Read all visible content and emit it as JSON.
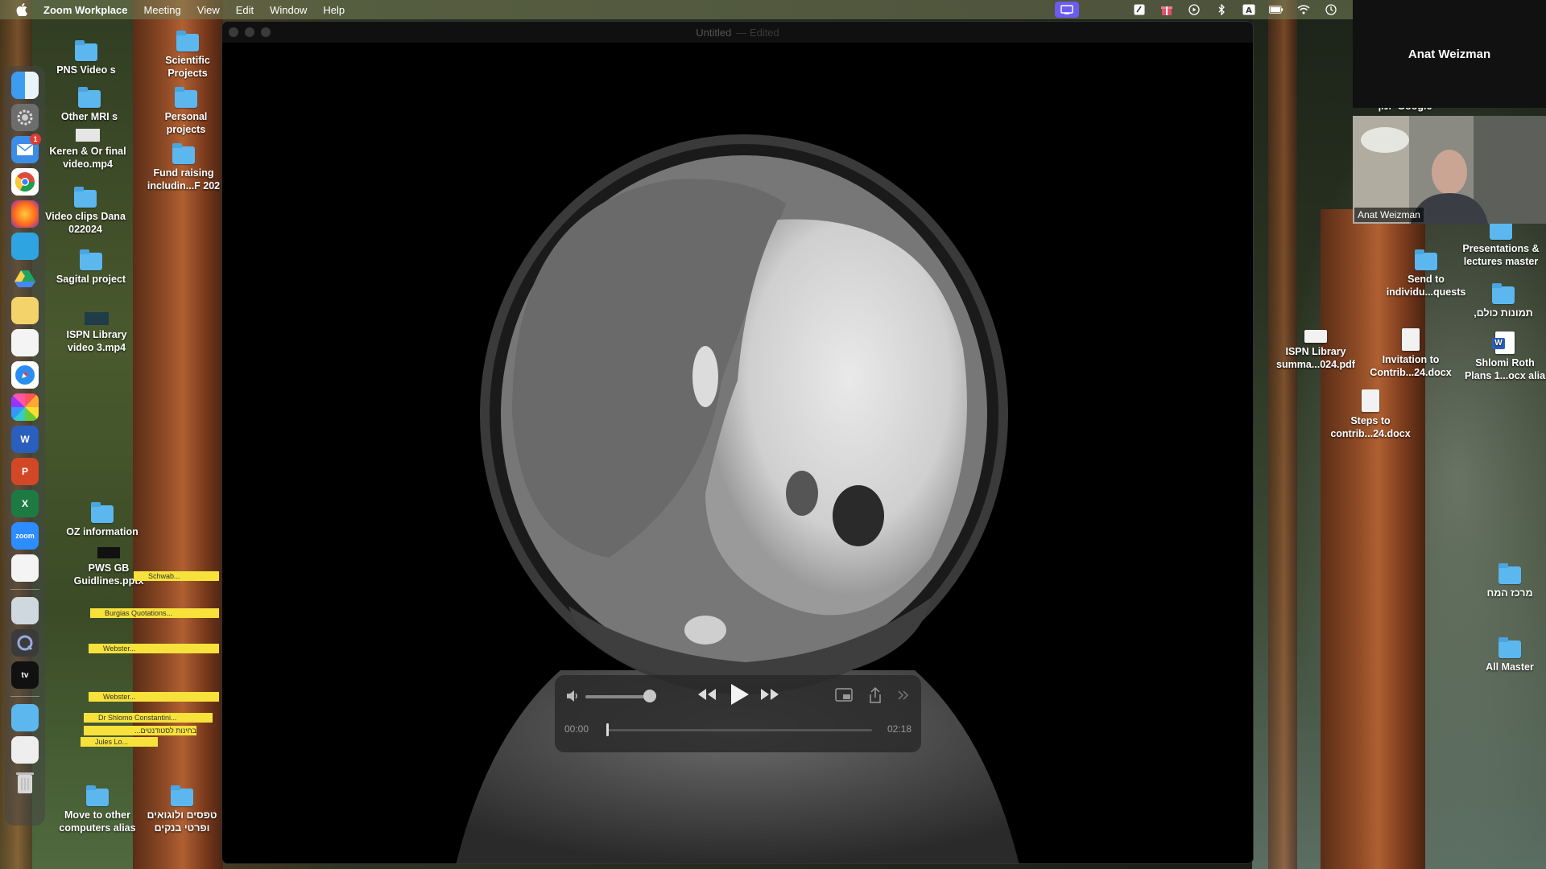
{
  "menubar": {
    "app_name": "Zoom Workplace",
    "items": [
      "Meeting",
      "View",
      "Edit",
      "Window",
      "Help"
    ]
  },
  "window": {
    "title": "Untitled",
    "title_suffix": "— Edited"
  },
  "player": {
    "current_time": "00:00",
    "total_time": "02:18",
    "progress": 0.0,
    "volume": 1.0
  },
  "zoom": {
    "participant_name": "Anat Weizman",
    "video_label": "Anat Weizman"
  },
  "dock": {
    "mail_badge": "1",
    "zoom_label": "zoom"
  },
  "desktop_left": {
    "pns_videos": "PNS Video s",
    "scientific_projects": "Scientific Projects",
    "other_mris": "Other MRI s",
    "personal_projects": "Personal projects",
    "keren_or": "Keren & Or final video.mp4",
    "fund_raising": "Fund raising includin...F 202",
    "video_clips_dana": "Video clips Dana 022024",
    "sagital_project": "Sagital project",
    "ispn_library_video": "ISPN Library video 3.mp4",
    "oz_information": "OZ information",
    "pws_gb": "PWS GB Guidlines.pptx",
    "move_to_other": "Move to other computers alias",
    "hebrew_folder": "טפסים ולוגואים ופרטי בנקים"
  },
  "stickies": {
    "schwab": "Schwab...",
    "burgias": "Burgias Quotations...",
    "webster1": "Webster...",
    "webster2": "Webster...",
    "dr_shlomo": "Dr Shlomo Constantini...",
    "hebrew_note": "בחינות לסטודנטים...",
    "jules": "Jules Lo..."
  },
  "desktop_right": {
    "google_heb": "Google יומן",
    "presentations": "Presentations & lectures master",
    "send_to": "Send to individu...quests",
    "tmunot": "תמונות כולם,",
    "ispn_summary": "ISPN Library summa...024.pdf",
    "invitation": "Invitation to Contrib...24.docx",
    "shlomi_roth": "Shlomi Roth Plans 1...ocx alia",
    "steps_to": "Steps to contrib...24.docx",
    "merkaz": "מרכז המח",
    "all_master": "All Master"
  }
}
